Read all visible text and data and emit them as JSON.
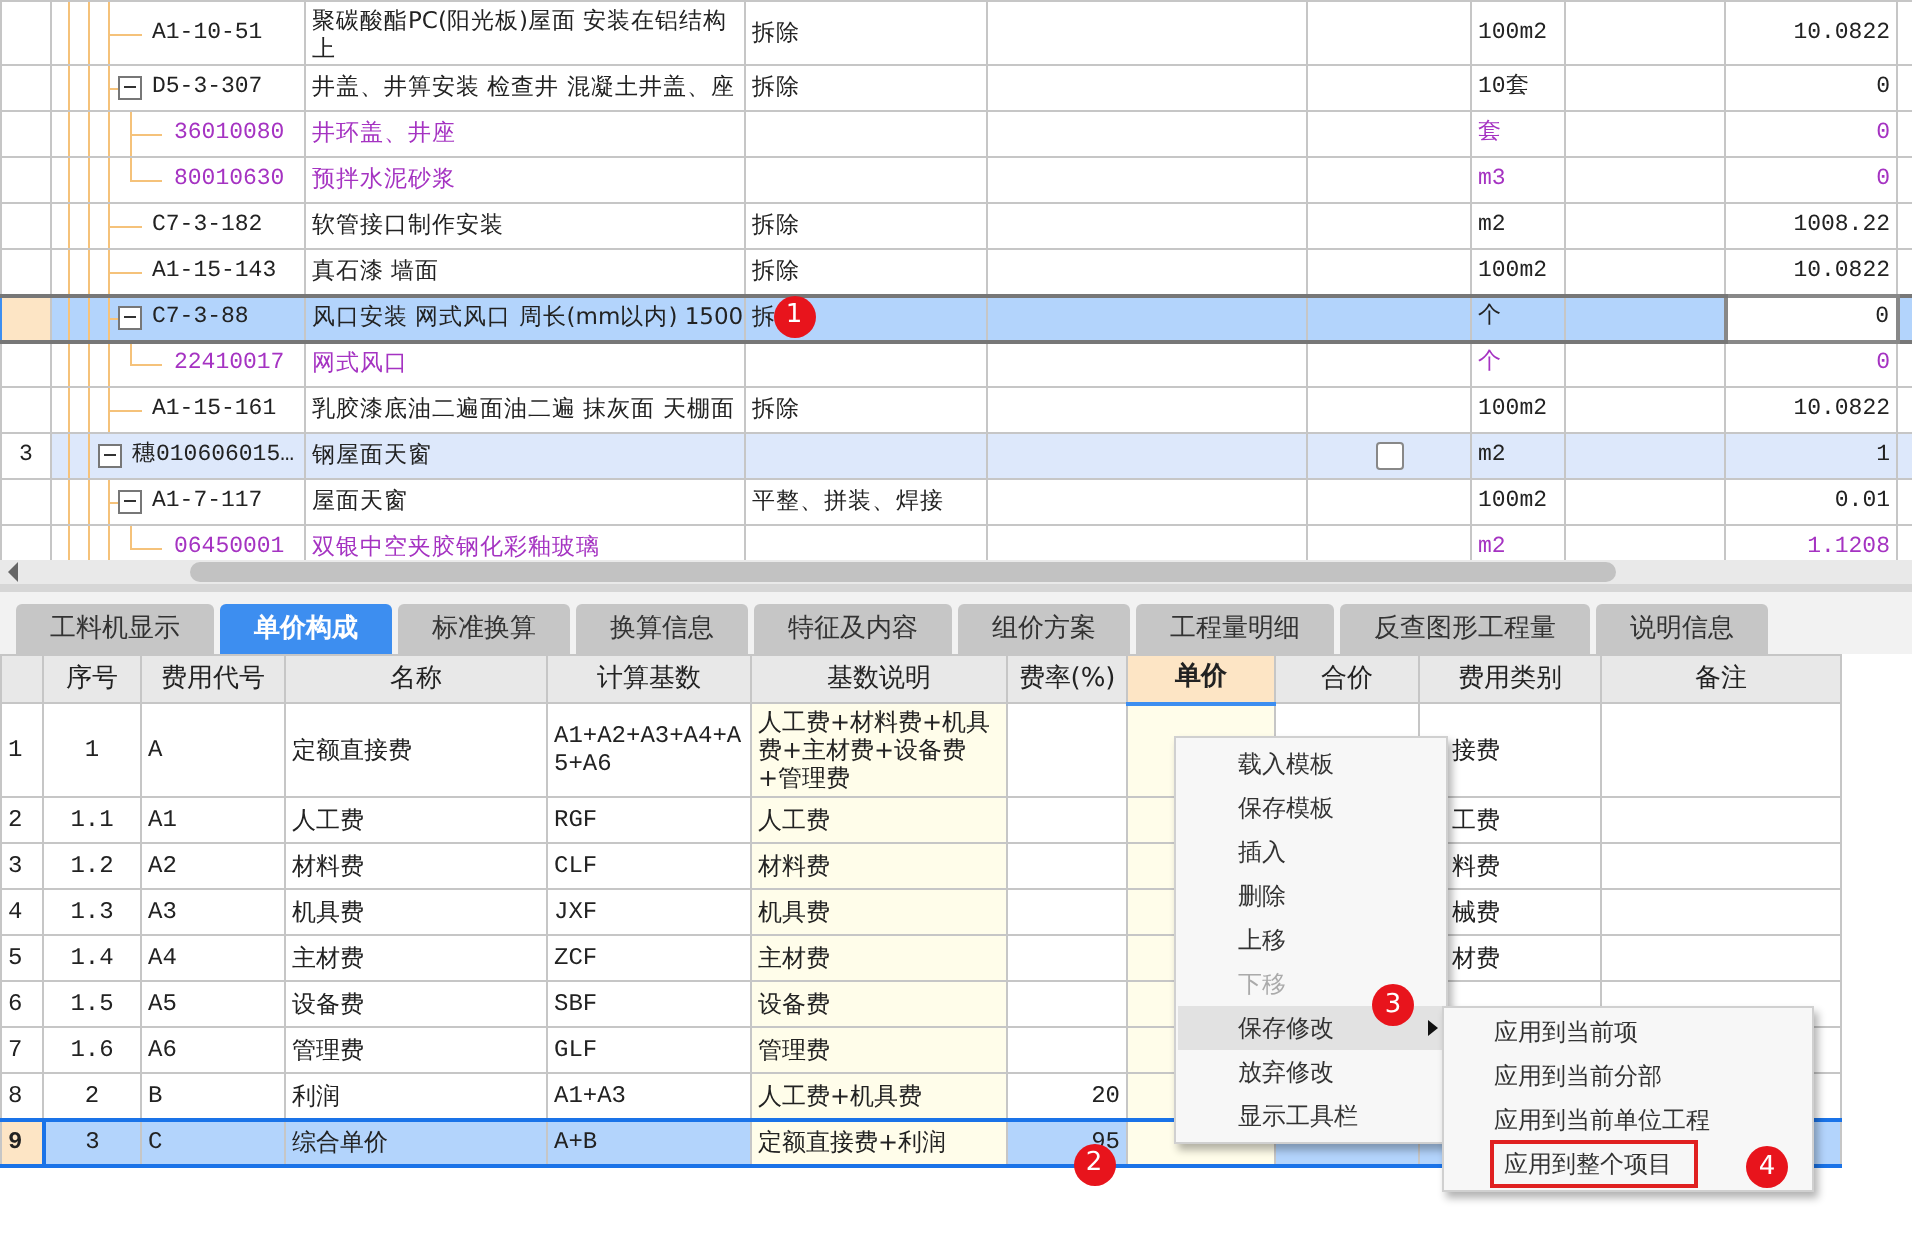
{
  "top_grid": {
    "rows": [
      {
        "kind": "quota",
        "code": "A1-10-51",
        "name": "聚碳酸酯PC(阳光板)屋面 安装在铝结构上",
        "feature": "拆除",
        "unit": "100m2",
        "quantity": "10.0822",
        "selected": false
      },
      {
        "kind": "quota",
        "code": "D5-3-307",
        "name": "井盖、井箅安装 检查井 混凝土井盖、座",
        "feature": "拆除",
        "unit": "10套",
        "quantity": "0",
        "selected": false,
        "expanded": true,
        "children": [
          {
            "kind": "material",
            "code": "36010080",
            "name": "井环盖、井座",
            "unit": "套",
            "quantity": "0",
            "selected": false
          },
          {
            "kind": "material",
            "code": "80010630",
            "name": "预拌水泥砂浆",
            "unit": "m3",
            "quantity": "0",
            "selected": false
          }
        ]
      },
      {
        "kind": "quota",
        "code": "C7-3-182",
        "name": "软管接口制作安装",
        "feature": "拆除",
        "unit": "m2",
        "quantity": "1008.22",
        "selected": false
      },
      {
        "kind": "quota",
        "code": "A1-15-143",
        "name": "真石漆 墙面",
        "feature": "拆除",
        "unit": "100m2",
        "quantity": "10.0822",
        "selected": false
      },
      {
        "kind": "quota",
        "code": "C7-3-88",
        "name": "风口安装 网式风口 周长(mm以内) 1500",
        "feature": "拆",
        "badge": "1",
        "unit": "个",
        "quantity": "0",
        "selected": true,
        "expanded": true,
        "children": [
          {
            "kind": "material",
            "code": "22410017",
            "name": "网式风口",
            "unit": "个",
            "quantity": "0",
            "selected": false
          }
        ]
      },
      {
        "kind": "quota",
        "code": "A1-15-161",
        "name": "乳胶漆底油二遍面油二遍 抹灰面 天棚面",
        "feature": "拆除",
        "unit": "100m2",
        "quantity": "10.0822",
        "selected": false
      },
      {
        "kind": "group",
        "row_no": "3",
        "code": "穗010606015…",
        "name": "钢屋面天窗",
        "checked": false,
        "unit": "m2",
        "quantity": "1",
        "selected": false,
        "expanded": true,
        "children": [
          {
            "kind": "quota",
            "code": "A1-7-117",
            "name": "屋面天窗",
            "feature": "平整、拼装、焊接",
            "unit": "100m2",
            "quantity": "0.01",
            "selected": false,
            "expanded": true,
            "children": [
              {
                "kind": "material",
                "code": "06450001",
                "name": "双银中空夹胶钢化彩釉玻璃",
                "unit": "m2",
                "quantity": "1.1208",
                "selected": false
              }
            ]
          }
        ]
      }
    ]
  },
  "tabs": [
    {
      "label": "工料机显示",
      "selected": false
    },
    {
      "label": "单价构成",
      "selected": true
    },
    {
      "label": "标准换算",
      "selected": false
    },
    {
      "label": "换算信息",
      "selected": false
    },
    {
      "label": "特征及内容",
      "selected": false
    },
    {
      "label": "组价方案",
      "selected": false
    },
    {
      "label": "工程量明细",
      "selected": false
    },
    {
      "label": "反查图形工程量",
      "selected": false
    },
    {
      "label": "说明信息",
      "selected": false
    }
  ],
  "cost_table": {
    "columns": [
      {
        "label": "序号",
        "selected": false
      },
      {
        "label": "费用代号",
        "selected": false
      },
      {
        "label": "名称",
        "selected": false
      },
      {
        "label": "计算基数",
        "selected": false
      },
      {
        "label": "基数说明",
        "selected": false
      },
      {
        "label": "费率(%)",
        "selected": false
      },
      {
        "label": "单价",
        "selected": true
      },
      {
        "label": "合价",
        "selected": false
      },
      {
        "label": "费用类别",
        "selected": false
      },
      {
        "label": "备注",
        "selected": false
      }
    ],
    "rows": [
      {
        "row_no": "1",
        "seq": "1",
        "code": "A",
        "name": "定额直接费",
        "base": "A1+A2+A3+A4+A5+A6",
        "base_desc": "人工费+材料费+机具费+主材费+设备费+管理费",
        "category": "接费",
        "selected": false
      },
      {
        "row_no": "2",
        "seq": "1.1",
        "code": "A1",
        "name": "人工费",
        "base": "RGF",
        "base_desc": "人工费",
        "category": "工费",
        "selected": false
      },
      {
        "row_no": "3",
        "seq": "1.2",
        "code": "A2",
        "name": "材料费",
        "base": "CLF",
        "base_desc": "材料费",
        "category": "料费",
        "selected": false
      },
      {
        "row_no": "4",
        "seq": "1.3",
        "code": "A3",
        "name": "机具费",
        "base": "JXF",
        "base_desc": "机具费",
        "category": "械费",
        "selected": false
      },
      {
        "row_no": "5",
        "seq": "1.4",
        "code": "A4",
        "name": "主材费",
        "base": "ZCF",
        "base_desc": "主材费",
        "category": "材费",
        "selected": false
      },
      {
        "row_no": "6",
        "seq": "1.5",
        "code": "A5",
        "name": "设备费",
        "base": "SBF",
        "base_desc": "设备费",
        "selected": false
      },
      {
        "row_no": "7",
        "seq": "1.6",
        "code": "A6",
        "name": "管理费",
        "base": "GLF",
        "base_desc": "管理费",
        "selected": false
      },
      {
        "row_no": "8",
        "seq": "2",
        "code": "B",
        "name": "利润",
        "base": "A1+A3",
        "base_desc": "人工费+机具费",
        "rate": "20",
        "selected": false
      },
      {
        "row_no": "9",
        "seq": "3",
        "code": "C",
        "name": "综合单价",
        "base": "A+B",
        "base_desc": "定额直接费+利润",
        "rate": "95",
        "rate_badge": "2",
        "selected": true
      }
    ]
  },
  "context_menu": {
    "items": [
      {
        "label": "载入模板",
        "disabled": false,
        "selected": false
      },
      {
        "label": "保存模板",
        "disabled": false,
        "selected": false
      },
      {
        "label": "插入",
        "disabled": false,
        "selected": false
      },
      {
        "label": "删除",
        "disabled": false,
        "selected": false
      },
      {
        "label": "上移",
        "disabled": false,
        "selected": false
      },
      {
        "label": "下移",
        "disabled": true,
        "selected": false
      },
      {
        "label": "保存修改",
        "disabled": false,
        "selected": true,
        "badge": "3",
        "submenu": {
          "items": [
            {
              "label": "应用到当前项",
              "outlined": false
            },
            {
              "label": "应用到当前分部",
              "outlined": false
            },
            {
              "label": "应用到当前单位工程",
              "outlined": false
            },
            {
              "label": "应用到整个项目",
              "outlined": true,
              "badge": "4"
            }
          ]
        }
      },
      {
        "label": "放弃修改",
        "disabled": false,
        "selected": false
      },
      {
        "label": "显示工具栏",
        "disabled": false,
        "selected": false
      }
    ]
  }
}
